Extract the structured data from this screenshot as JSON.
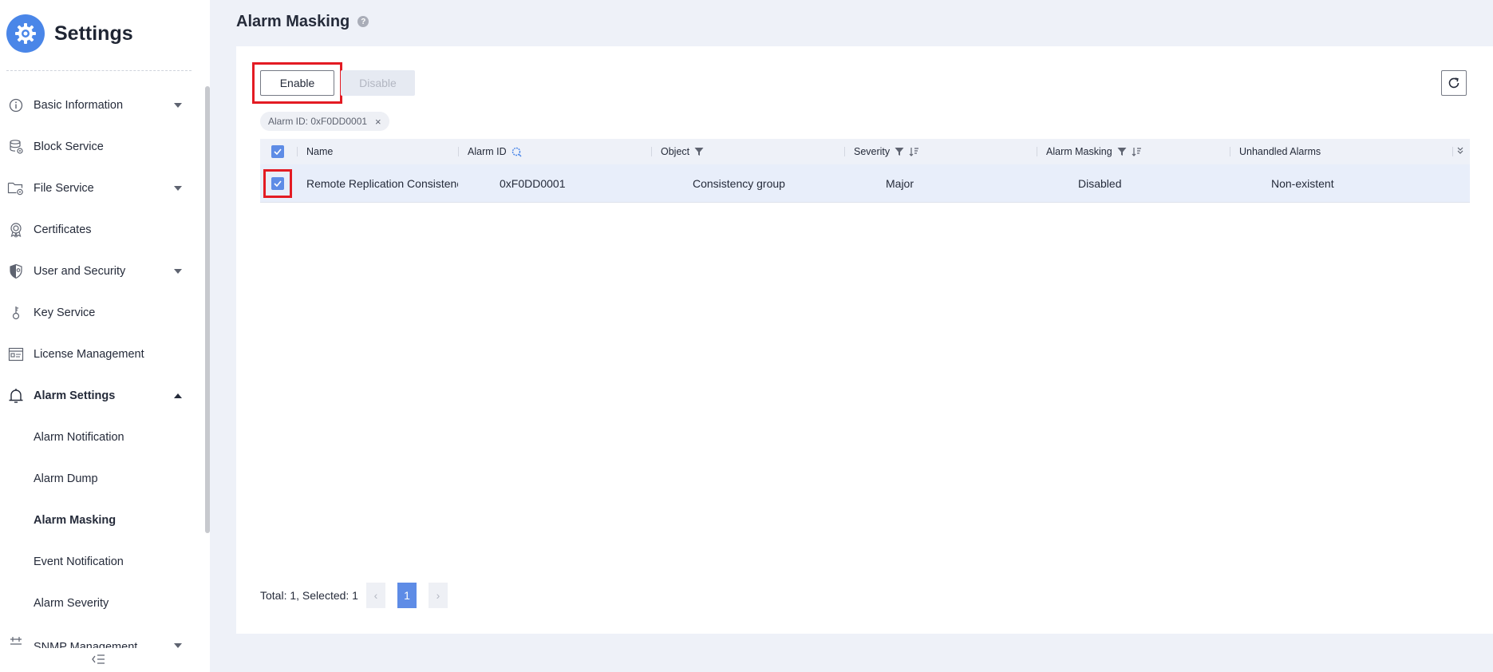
{
  "app": {
    "title": "Settings"
  },
  "sidebar": {
    "items": [
      {
        "label": "Basic Information",
        "icon": "info-icon",
        "expandable": true
      },
      {
        "label": "Block Service",
        "icon": "block-storage-icon",
        "expandable": false
      },
      {
        "label": "File Service",
        "icon": "folder-icon",
        "expandable": true
      },
      {
        "label": "Certificates",
        "icon": "certificate-icon",
        "expandable": false
      },
      {
        "label": "User and Security",
        "icon": "shield-icon",
        "expandable": true
      },
      {
        "label": "Key Service",
        "icon": "key-icon",
        "expandable": false
      },
      {
        "label": "License Management",
        "icon": "license-icon",
        "expandable": false
      },
      {
        "label": "Alarm Settings",
        "icon": "bell-icon",
        "expandable": true,
        "expanded": true
      },
      {
        "label": "Alarm Notification",
        "sub": true
      },
      {
        "label": "Alarm Dump",
        "sub": true
      },
      {
        "label": "Alarm Masking",
        "sub": true,
        "active": true
      },
      {
        "label": "Event Notification",
        "sub": true
      },
      {
        "label": "Alarm Severity",
        "sub": true
      },
      {
        "label": "SNMP Management",
        "icon": "snmp-icon",
        "expandable": true
      }
    ]
  },
  "page": {
    "title": "Alarm Masking",
    "help_icon": "?"
  },
  "toolbar": {
    "enable_label": "Enable",
    "disable_label": "Disable",
    "refresh_icon": "refresh-icon"
  },
  "filter": {
    "tag_label": "Alarm ID: 0xF0DD0001",
    "remove_glyph": "×"
  },
  "table": {
    "columns": [
      "Name",
      "Alarm ID",
      "Object",
      "Severity",
      "Alarm Masking",
      "Unhandled Alarms"
    ],
    "rows": [
      {
        "selected": true,
        "name": "Remote Replication Consistency ...",
        "alarm_id": "0xF0DD0001",
        "object": "Consistency group",
        "severity": "Major",
        "alarm_masking": "Disabled",
        "unhandled_alarms": "Non-existent"
      }
    ]
  },
  "pagination": {
    "summary": "Total: 1, Selected: 1",
    "current_page": "1",
    "prev_glyph": "‹",
    "next_glyph": "›"
  },
  "colors": {
    "accent": "#5e8ce6",
    "brand": "#4a86e8",
    "highlight": "#e31b23",
    "page_bg": "#eef1f8"
  }
}
